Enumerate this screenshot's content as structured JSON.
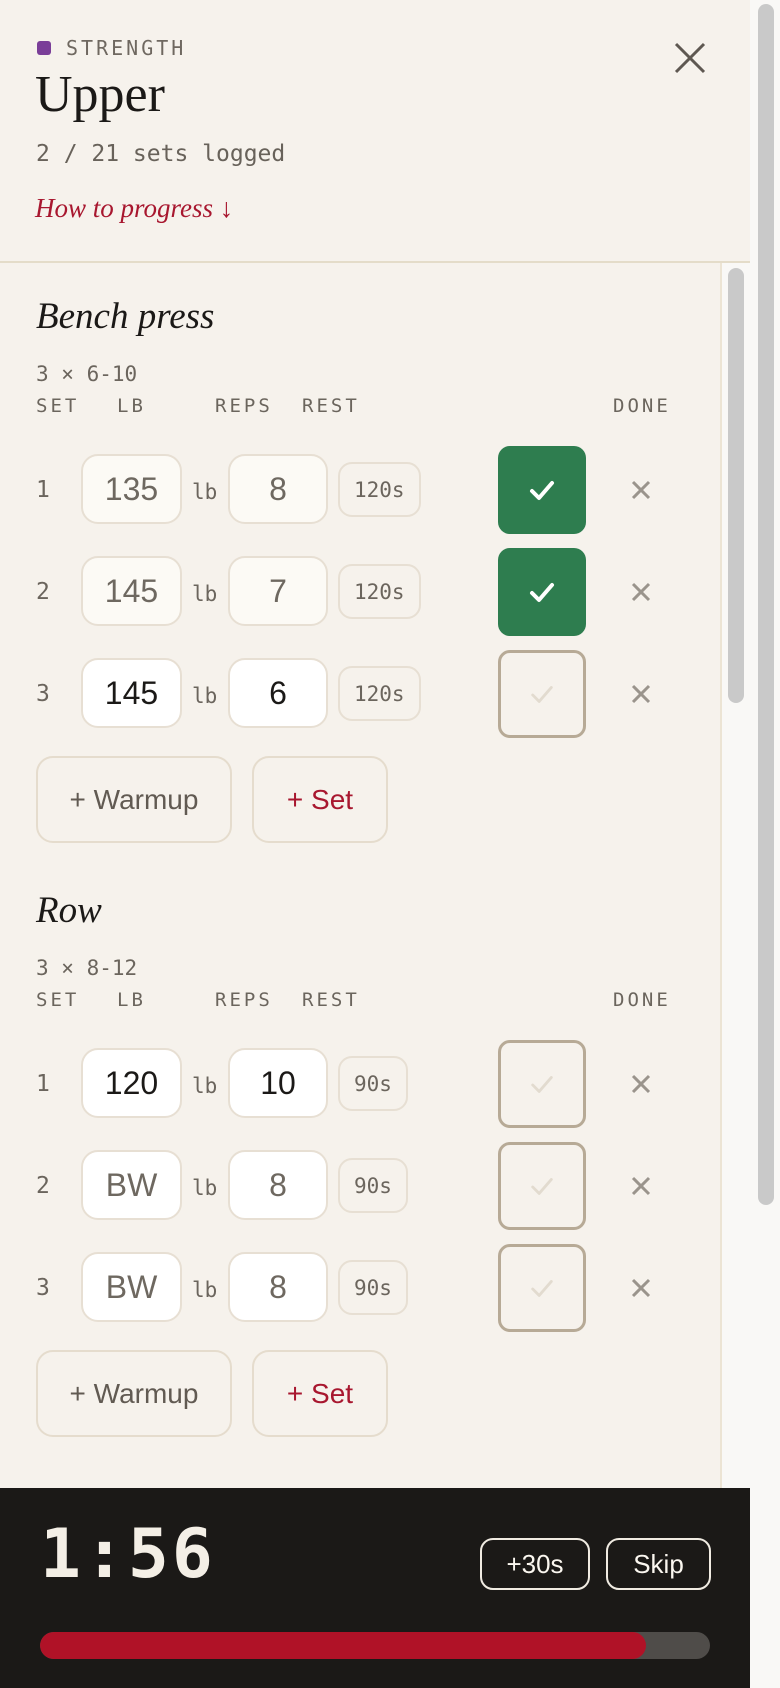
{
  "header": {
    "category": "STRENGTH",
    "category_color": "#7a3e98",
    "title": "Upper",
    "progress_text": "2 / 21 sets logged",
    "how_to_link": "How to progress ↓",
    "close_icon": "close-icon"
  },
  "columns": {
    "set": "SET",
    "weight": "LB",
    "reps": "REPS",
    "rest": "REST",
    "done": "DONE"
  },
  "unit_label": "lb",
  "exercises": [
    {
      "name": "Bench press",
      "scheme": "3 × 6-10",
      "sets": [
        {
          "num": "1",
          "weight": "135",
          "reps": "8",
          "rest": "120s",
          "done": true
        },
        {
          "num": "2",
          "weight": "145",
          "reps": "7",
          "rest": "120s",
          "done": true
        },
        {
          "num": "3",
          "weight": "145",
          "reps": "6",
          "rest": "120s",
          "done": false
        }
      ],
      "warmup_label": "+ Warmup",
      "add_set_label": "+ Set"
    },
    {
      "name": "Row",
      "scheme": "3 × 8-12",
      "sets": [
        {
          "num": "1",
          "weight": "120",
          "reps": "10",
          "rest": "90s",
          "done": false
        },
        {
          "num": "2",
          "weight": "",
          "weight_placeholder": "BW",
          "reps": "8",
          "rest": "90s",
          "done": false
        },
        {
          "num": "3",
          "weight": "",
          "weight_placeholder": "BW",
          "reps": "8",
          "rest": "90s",
          "done": false
        }
      ],
      "warmup_label": "+ Warmup",
      "add_set_label": "+ Set"
    }
  ],
  "rest_timer": {
    "time": "1:56",
    "add_label": "+30s",
    "skip_label": "Skip",
    "progress": 0.905
  },
  "colors": {
    "accent": "#a8172f",
    "done_green": "#2e7d4f",
    "timer_bg": "#1b1917"
  }
}
